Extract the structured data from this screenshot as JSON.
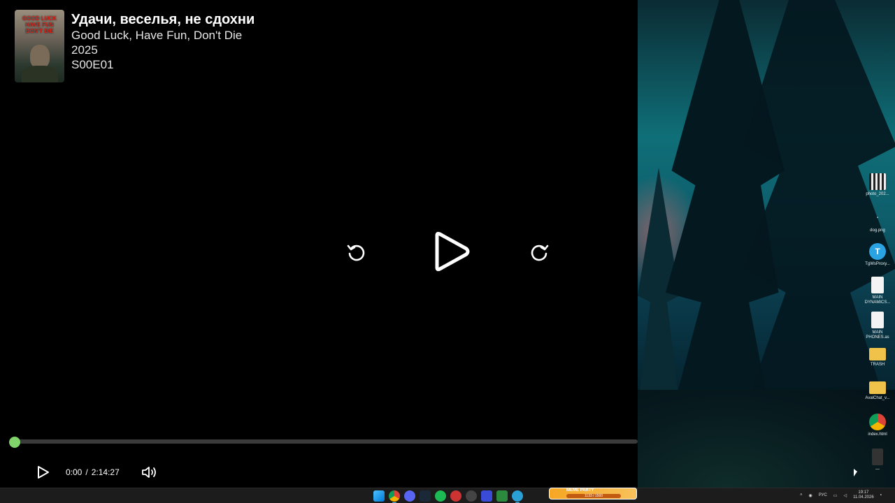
{
  "player": {
    "title": "Удачи, веселья, не сдохни",
    "original_title": "Good Luck, Have Fun, Don't Die",
    "year": "2025",
    "episode": "S00E01",
    "poster_text": "GOOD LUCK HAVE FUN DON'T DIE",
    "current_time": "0:00",
    "time_separator": "/",
    "duration": "2:14:27",
    "progress_fraction": 0.0,
    "accent_color": "#7fd36a",
    "icons": {
      "rewind": "rewind-icon",
      "play": "play-icon",
      "forward": "forward-icon",
      "volume": "volume-icon"
    }
  },
  "desktop": {
    "icons": [
      {
        "label": "photo_202...",
        "icon": "image-icon"
      },
      {
        "label": "dog.png",
        "icon": "image-icon"
      },
      {
        "label": "TgWsProxy...",
        "icon": "telegram-icon"
      },
      {
        "label": "MAIN DYNAMICS...",
        "icon": "document-icon"
      },
      {
        "label": "MAIN PHONES.as",
        "icon": "document-icon"
      },
      {
        "label": "TRASH",
        "icon": "folder-icon"
      },
      {
        "label": "AvalChat_v...",
        "icon": "folder-icon"
      },
      {
        "label": "index.html",
        "icon": "chrome-icon"
      },
      {
        "label": "—",
        "icon": "file-icon"
      }
    ]
  },
  "taskbar": {
    "widget_title": "MEME PARTY",
    "widget_value": "1133 / 1500",
    "language": "РУС",
    "time": "19:17",
    "date": "11.04.2026"
  }
}
